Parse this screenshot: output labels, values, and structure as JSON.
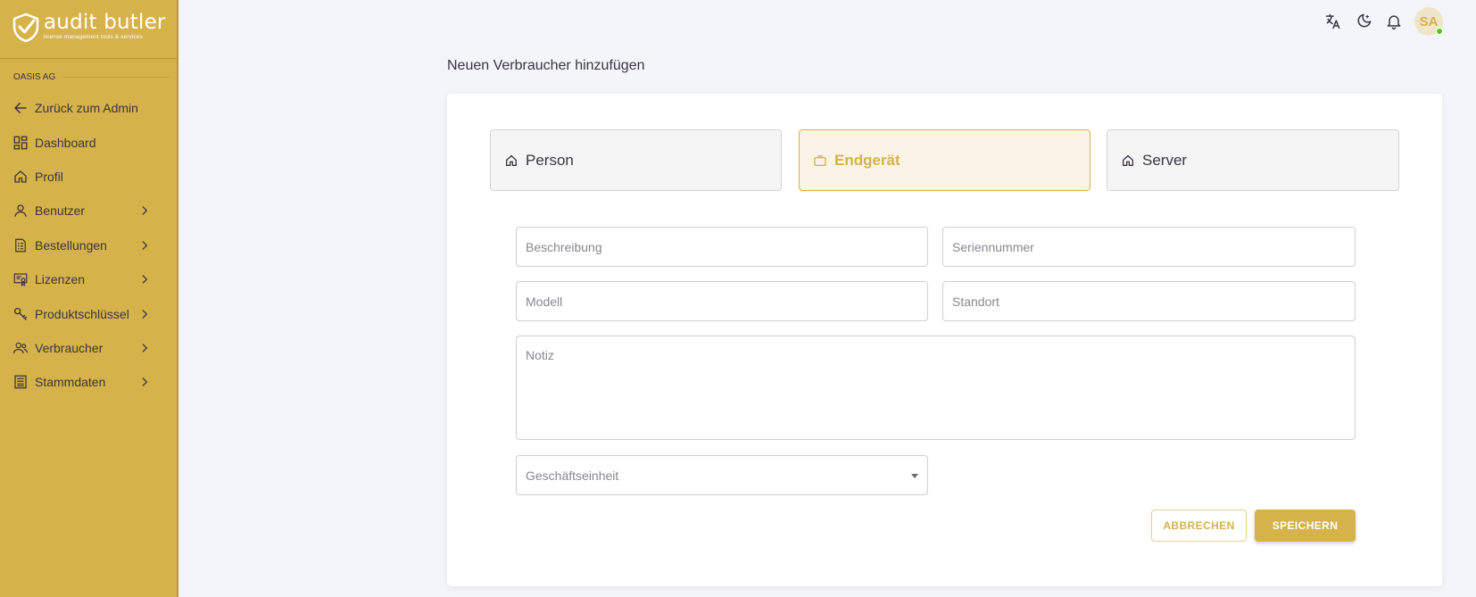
{
  "brand": {
    "name": "audit butler",
    "tagline": "license management tools & services",
    "primary_color": "#d6b24a"
  },
  "sidebar": {
    "org_label": "OASIS AG",
    "items": [
      {
        "label": "Zurück zum Admin",
        "icon": "arrow-left-icon",
        "has_children": false
      },
      {
        "label": "Dashboard",
        "icon": "dashboard-icon",
        "has_children": false
      },
      {
        "label": "Profil",
        "icon": "home-icon",
        "has_children": false
      },
      {
        "label": "Benutzer",
        "icon": "user-icon",
        "has_children": true
      },
      {
        "label": "Bestellungen",
        "icon": "receipt-icon",
        "has_children": true
      },
      {
        "label": "Lizenzen",
        "icon": "certificate-icon",
        "has_children": true
      },
      {
        "label": "Produktschlüssel",
        "icon": "key-icon",
        "has_children": true
      },
      {
        "label": "Verbraucher",
        "icon": "users-icon",
        "has_children": true
      },
      {
        "label": "Stammdaten",
        "icon": "list-icon",
        "has_children": true
      }
    ]
  },
  "topbar": {
    "icons": [
      "translate-icon",
      "dark-mode-icon",
      "bell-icon"
    ],
    "avatar_initials": "SA",
    "avatar_status": "online"
  },
  "page": {
    "title": "Neuen Verbraucher hinzufügen"
  },
  "type_tabs": [
    {
      "label": "Person",
      "icon": "home-icon",
      "active": false
    },
    {
      "label": "Endgerät",
      "icon": "briefcase-icon",
      "active": true
    },
    {
      "label": "Server",
      "icon": "home-icon",
      "active": false
    }
  ],
  "form": {
    "beschreibung": {
      "placeholder": "Beschreibung",
      "value": ""
    },
    "seriennummer": {
      "placeholder": "Seriennummer",
      "value": ""
    },
    "modell": {
      "placeholder": "Modell",
      "value": ""
    },
    "standort": {
      "placeholder": "Standort",
      "value": ""
    },
    "notiz": {
      "placeholder": "Notiz",
      "value": ""
    },
    "geschaeftseinheit": {
      "placeholder": "Geschäftseinheit",
      "value": ""
    }
  },
  "actions": {
    "cancel_label": "ABBRECHEN",
    "save_label": "SPEICHERN"
  }
}
